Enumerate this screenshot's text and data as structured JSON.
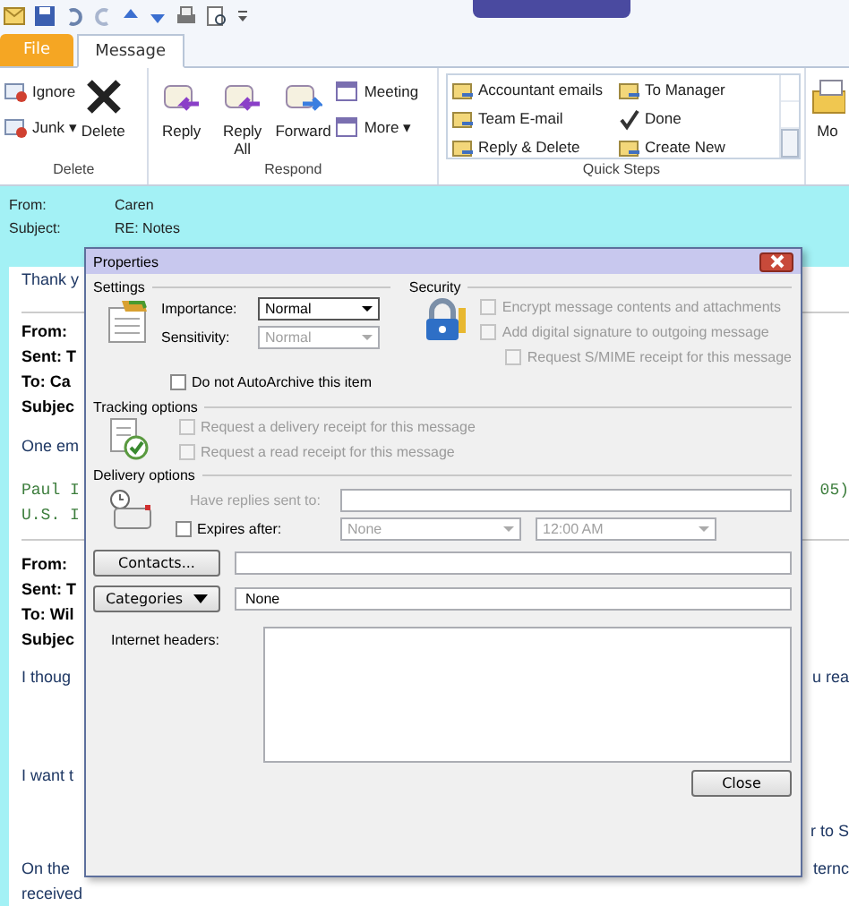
{
  "tabs": [
    {
      "label": "File",
      "kind": "file",
      "selected": false
    },
    {
      "label": "Message",
      "kind": "tab",
      "selected": true
    }
  ],
  "ribbon_groups": [
    {
      "label": "Delete",
      "kind": "delete",
      "items": [
        {
          "label": "Ignore",
          "kind": "small"
        },
        {
          "label": "Junk ▾",
          "kind": "small"
        },
        {
          "label": "Delete",
          "kind": "large"
        }
      ]
    },
    {
      "label": "Respond",
      "kind": "respond",
      "items": [
        {
          "label": "Reply",
          "kind": "large"
        },
        {
          "label": "Reply All",
          "kind": "large"
        },
        {
          "label": "Forward",
          "kind": "large"
        },
        {
          "label": "Meeting",
          "kind": "small"
        },
        {
          "label": "More ▾",
          "kind": "small"
        }
      ]
    },
    {
      "label": "Quick Steps",
      "kind": "quicksteps",
      "items": [
        {
          "label": "Accountant emails"
        },
        {
          "label": "To Manager"
        },
        {
          "label": "Team E-mail"
        },
        {
          "label": "Done"
        },
        {
          "label": "Reply & Delete"
        },
        {
          "label": "Create New"
        }
      ]
    },
    {
      "label": "Mo",
      "kind": "move"
    }
  ],
  "header": [
    {
      "label": "From:",
      "value": "Caren"
    },
    {
      "label": "Subject:",
      "value": "RE: Notes"
    }
  ],
  "body": [
    {
      "kind": "text",
      "left": "Thank y"
    },
    {
      "kind": "rule"
    },
    {
      "kind": "bold",
      "left": "From:"
    },
    {
      "kind": "bold",
      "left": "Sent: T"
    },
    {
      "kind": "bold",
      "left": "To: Ca"
    },
    {
      "kind": "bold",
      "left": "Subjec"
    },
    {
      "kind": "text",
      "left": "One em"
    },
    {
      "kind": "mono",
      "left": "Paul I",
      "right": "05)"
    },
    {
      "kind": "mono",
      "left": "U.S. I"
    },
    {
      "kind": "rule"
    },
    {
      "kind": "bold",
      "left": "From:"
    },
    {
      "kind": "bold",
      "left": "Sent: T"
    },
    {
      "kind": "bold",
      "left": "To: Wil"
    },
    {
      "kind": "bold",
      "left": "Subjec"
    },
    {
      "kind": "text",
      "left": "I thoug",
      "right": "u rea"
    },
    {
      "kind": "text",
      "left": "I want t"
    },
    {
      "kind": "text",
      "right": "r to S"
    },
    {
      "kind": "text",
      "left": "On the",
      "right": "ternc"
    },
    {
      "kind": "text",
      "left": "received"
    }
  ],
  "dialog": {
    "title": "Properties",
    "settings": {
      "heading": "Settings",
      "importance_label": "Importance:",
      "importance": "Normal",
      "sensitivity_label": "Sensitivity:",
      "sensitivity": "Normal",
      "sensitivity_disabled": true
    },
    "security": {
      "heading": "Security",
      "options": [
        {
          "label": "Encrypt message contents and attachments",
          "checked": false,
          "disabled": true
        },
        {
          "label": "Add digital signature to outgoing message",
          "checked": false,
          "disabled": true
        },
        {
          "label": "Request S/MIME receipt for this message",
          "checked": false,
          "disabled": true
        }
      ]
    },
    "autoarchive": {
      "label": "Do not AutoArchive this item",
      "checked": false,
      "disabled": false
    },
    "tracking": {
      "heading": "Tracking options",
      "options": [
        {
          "label": "Request a delivery receipt for this message",
          "checked": false,
          "disabled": true
        },
        {
          "label": "Request a read receipt for this message",
          "checked": false,
          "disabled": true
        }
      ]
    },
    "delivery": {
      "heading": "Delivery options",
      "replies_label": "Have replies sent to:",
      "replies_disabled": true,
      "expires": {
        "label": "Expires after:",
        "checked": false,
        "disabled": false
      },
      "expires_date": "None",
      "expires_time": "12:00 AM"
    },
    "contacts_button": "Contacts...",
    "categories_button": "Categories",
    "categories_value": "None",
    "headers_label": "Internet headers:",
    "close_button": "Close"
  }
}
